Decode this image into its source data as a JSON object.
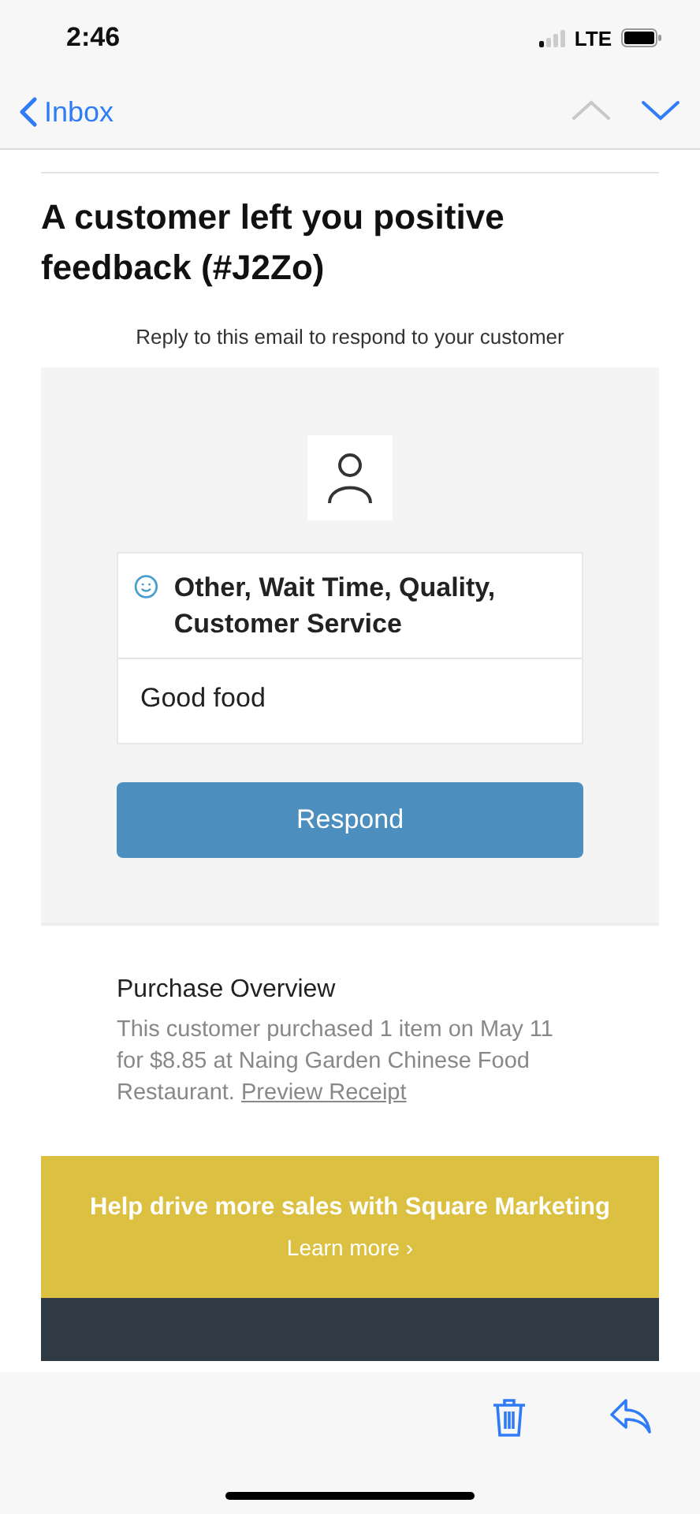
{
  "status_bar": {
    "time": "2:46",
    "network": "LTE"
  },
  "nav": {
    "back_label": "Inbox",
    "arrows": [
      {
        "kind": "up",
        "disabled": true
      },
      {
        "kind": "down",
        "disabled": false
      }
    ]
  },
  "email": {
    "title": "A customer left you positive feedback (#J2Zo)",
    "subtitle": "Reply to this email to respond to your customer",
    "feedback": {
      "categories": "Other, Wait Time, Quality, Customer Service",
      "comment": "Good food"
    },
    "button": "Respond",
    "purchase": {
      "heading": "Purchase Overview",
      "text": "This customer purchased 1 item on May 11 for $8.85 at Naing Garden Chinese Food Restaurant.",
      "link": "Preview Receipt"
    },
    "banner": {
      "headline": "Help drive more sales with Square Marketing",
      "link": "Learn more ›"
    }
  }
}
